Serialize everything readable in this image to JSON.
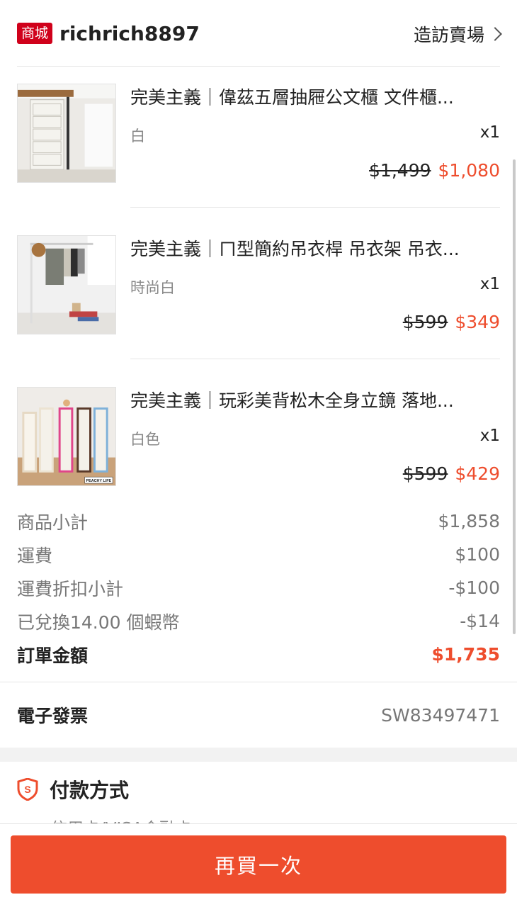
{
  "shop": {
    "badge": "商城",
    "name": "richrich8897",
    "visit_label": "造訪賣場"
  },
  "items": [
    {
      "title": "完美主義｜偉茲五層抽屜公文櫃 文件櫃...",
      "variant": "白",
      "qty": "x1",
      "price_original": "$1,499",
      "price_sale": "$1,080",
      "thumb_icon": "drawer-cabinet-image"
    },
    {
      "title": "完美主義｜ㄇ型簡約吊衣桿 吊衣架 吊衣...",
      "variant": "時尚白",
      "qty": "x1",
      "price_original": "$599",
      "price_sale": "$349",
      "thumb_icon": "clothes-rack-image"
    },
    {
      "title": "完美主義｜玩彩美背松木全身立鏡 落地...",
      "variant": "白色",
      "qty": "x1",
      "price_original": "$599",
      "price_sale": "$429",
      "thumb_icon": "standing-mirror-image",
      "thumb_logo": "PEACHY LIFE"
    }
  ],
  "summary": {
    "subtotal_label": "商品小計",
    "subtotal_value": "$1,858",
    "shipping_label": "運費",
    "shipping_value": "$100",
    "shipping_discount_label": "運費折扣小計",
    "shipping_discount_value": "-$100",
    "coins_label": "已兌換14.00 個蝦幣",
    "coins_value": "-$14",
    "total_label": "訂單金額",
    "total_value": "$1,735"
  },
  "invoice": {
    "label": "電子發票",
    "value": "SW83497471"
  },
  "payment": {
    "title": "付款方式",
    "method": "信用卡/VISA金融卡"
  },
  "actions": {
    "buy_again": "再買一次"
  },
  "colors": {
    "accent": "#ee4d2d",
    "mall_badge": "#d0011b"
  }
}
